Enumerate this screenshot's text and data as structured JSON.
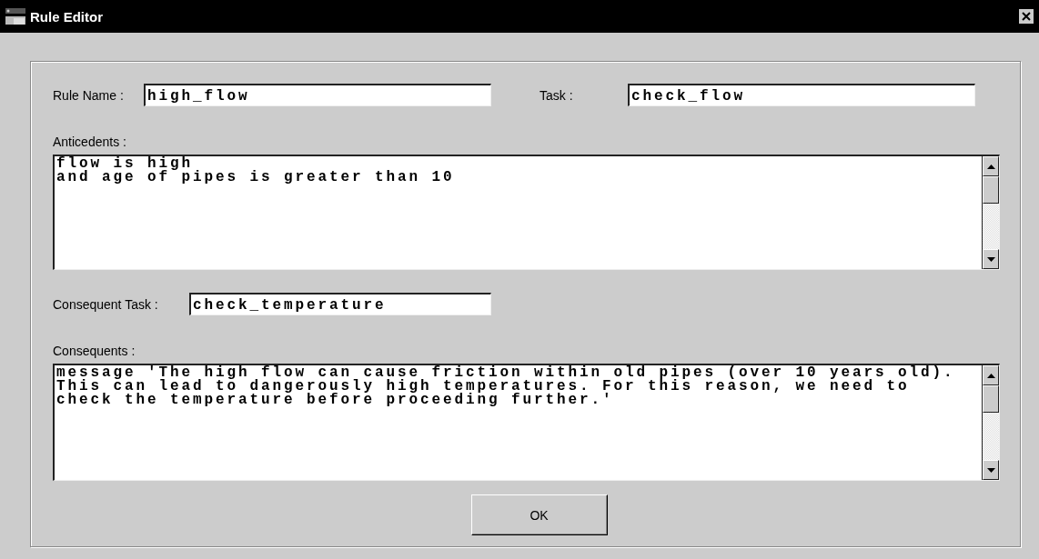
{
  "window": {
    "title": "Rule Editor"
  },
  "rule_name": {
    "label": "Rule Name :",
    "value": "high_flow"
  },
  "task": {
    "label": "Task :",
    "value": "check_flow"
  },
  "anticedents": {
    "label": "Anticedents :",
    "lines": [
      "flow is high",
      "and age of pipes is greater than 10"
    ]
  },
  "consequent_task": {
    "label": "Consequent Task :",
    "value": "check_temperature"
  },
  "consequents": {
    "label": "Consequents :",
    "lines": [
      "message 'The high flow can cause friction within old pipes (over 10 years old).",
      "This can lead to dangerously high temperatures. For this reason, we need to",
      "check the temperature before proceeding further.'"
    ]
  },
  "buttons": [
    "OK"
  ]
}
